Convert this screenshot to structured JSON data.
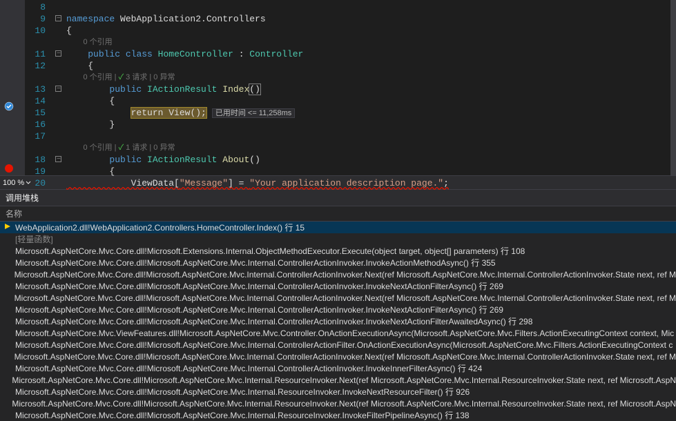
{
  "editor": {
    "lines": [
      {
        "num": "8",
        "codelens": null,
        "content": ""
      },
      {
        "num": "9",
        "codelens": null,
        "tokens": [
          {
            "t": "kw",
            "v": "namespace"
          },
          {
            "t": "p",
            "v": " WebApplication2.Controllers"
          }
        ],
        "outline": true
      },
      {
        "num": "10",
        "codelens": null,
        "tokens": [
          {
            "t": "p",
            "v": "{"
          }
        ]
      },
      {
        "num": "",
        "codelens": "0 个引用",
        "tokens": null
      },
      {
        "num": "11",
        "codelens": null,
        "tokens": [
          {
            "t": "p",
            "v": "    "
          },
          {
            "t": "kw",
            "v": "public"
          },
          {
            "t": "p",
            "v": " "
          },
          {
            "t": "kw",
            "v": "class"
          },
          {
            "t": "p",
            "v": " "
          },
          {
            "t": "type",
            "v": "HomeController"
          },
          {
            "t": "p",
            "v": " : "
          },
          {
            "t": "type",
            "v": "Controller"
          }
        ],
        "outline": true
      },
      {
        "num": "12",
        "codelens": null,
        "tokens": [
          {
            "t": "p",
            "v": "    {"
          }
        ]
      },
      {
        "num": "",
        "codelens": "0 个引用 | ✓ 3 请求 | 0 异常",
        "tokens": null
      },
      {
        "num": "13",
        "codelens": null,
        "tokens": [
          {
            "t": "p",
            "v": "        "
          },
          {
            "t": "kw",
            "v": "public"
          },
          {
            "t": "p",
            "v": " "
          },
          {
            "t": "type",
            "v": "IActionResult"
          },
          {
            "t": "p",
            "v": " "
          },
          {
            "t": "method",
            "v": "Index"
          },
          {
            "t": "caret",
            "v": "()"
          }
        ],
        "outline": true,
        "current": true
      },
      {
        "num": "14",
        "codelens": null,
        "tokens": [
          {
            "t": "p",
            "v": "        {"
          }
        ]
      },
      {
        "num": "15",
        "codelens": null,
        "tokens": [
          {
            "t": "p",
            "v": "            "
          },
          {
            "t": "hl",
            "v": "return View();"
          }
        ],
        "elapsed": "已用时间 <= 11,258ms"
      },
      {
        "num": "16",
        "codelens": null,
        "tokens": [
          {
            "t": "p",
            "v": "        }"
          }
        ]
      },
      {
        "num": "17",
        "codelens": null,
        "tokens": []
      },
      {
        "num": "",
        "codelens": "0 个引用 | ✓ 1 请求 | 0 异常",
        "tokens": null
      },
      {
        "num": "18",
        "codelens": null,
        "tokens": [
          {
            "t": "p",
            "v": "        "
          },
          {
            "t": "kw",
            "v": "public"
          },
          {
            "t": "p",
            "v": " "
          },
          {
            "t": "type",
            "v": "IActionResult"
          },
          {
            "t": "p",
            "v": " "
          },
          {
            "t": "method",
            "v": "About"
          },
          {
            "t": "p",
            "v": "()"
          }
        ],
        "outline": true
      },
      {
        "num": "19",
        "codelens": null,
        "tokens": [
          {
            "t": "p",
            "v": "        {"
          }
        ]
      },
      {
        "num": "20",
        "codelens": null,
        "tokens": [
          {
            "t": "p",
            "v": "            ViewData["
          },
          {
            "t": "str",
            "v": "\"Message\""
          },
          {
            "t": "p",
            "v": "] = "
          },
          {
            "t": "str",
            "v": "\"Your application description page.\""
          },
          {
            "t": "p",
            "v": ";"
          }
        ],
        "redunderline": true
      }
    ],
    "zoom": "100 %"
  },
  "callstack": {
    "panel_title": "调用堆栈",
    "column_header": "名称",
    "frames": [
      {
        "current": true,
        "text": "WebApplication2.dll!WebApplication2.Controllers.HomeController.Index() 行 15"
      },
      {
        "light": true,
        "text": "[轻量函数]"
      },
      {
        "text": "Microsoft.AspNetCore.Mvc.Core.dll!Microsoft.Extensions.Internal.ObjectMethodExecutor.Execute(object target, object[] parameters) 行 108"
      },
      {
        "text": "Microsoft.AspNetCore.Mvc.Core.dll!Microsoft.AspNetCore.Mvc.Internal.ControllerActionInvoker.InvokeActionMethodAsync() 行 355"
      },
      {
        "text": "Microsoft.AspNetCore.Mvc.Core.dll!Microsoft.AspNetCore.Mvc.Internal.ControllerActionInvoker.Next(ref Microsoft.AspNetCore.Mvc.Internal.ControllerActionInvoker.State next, ref M"
      },
      {
        "text": "Microsoft.AspNetCore.Mvc.Core.dll!Microsoft.AspNetCore.Mvc.Internal.ControllerActionInvoker.InvokeNextActionFilterAsync() 行 269"
      },
      {
        "text": "Microsoft.AspNetCore.Mvc.Core.dll!Microsoft.AspNetCore.Mvc.Internal.ControllerActionInvoker.Next(ref Microsoft.AspNetCore.Mvc.Internal.ControllerActionInvoker.State next, ref M"
      },
      {
        "text": "Microsoft.AspNetCore.Mvc.Core.dll!Microsoft.AspNetCore.Mvc.Internal.ControllerActionInvoker.InvokeNextActionFilterAsync() 行 269"
      },
      {
        "text": "Microsoft.AspNetCore.Mvc.Core.dll!Microsoft.AspNetCore.Mvc.Internal.ControllerActionInvoker.InvokeNextActionFilterAwaitedAsync() 行 298"
      },
      {
        "text": "Microsoft.AspNetCore.Mvc.ViewFeatures.dll!Microsoft.AspNetCore.Mvc.Controller.OnActionExecutionAsync(Microsoft.AspNetCore.Mvc.Filters.ActionExecutingContext context, Mic"
      },
      {
        "text": "Microsoft.AspNetCore.Mvc.Core.dll!Microsoft.AspNetCore.Mvc.Internal.ControllerActionFilter.OnActionExecutionAsync(Microsoft.AspNetCore.Mvc.Filters.ActionExecutingContext c"
      },
      {
        "text": "Microsoft.AspNetCore.Mvc.Core.dll!Microsoft.AspNetCore.Mvc.Internal.ControllerActionInvoker.Next(ref Microsoft.AspNetCore.Mvc.Internal.ControllerActionInvoker.State next, ref M"
      },
      {
        "text": "Microsoft.AspNetCore.Mvc.Core.dll!Microsoft.AspNetCore.Mvc.Internal.ControllerActionInvoker.InvokeInnerFilterAsync() 行 424"
      },
      {
        "text": "Microsoft.AspNetCore.Mvc.Core.dll!Microsoft.AspNetCore.Mvc.Internal.ResourceInvoker.Next(ref Microsoft.AspNetCore.Mvc.Internal.ResourceInvoker.State next, ref Microsoft.AspN"
      },
      {
        "text": "Microsoft.AspNetCore.Mvc.Core.dll!Microsoft.AspNetCore.Mvc.Internal.ResourceInvoker.InvokeNextResourceFilter() 行 926"
      },
      {
        "text": "Microsoft.AspNetCore.Mvc.Core.dll!Microsoft.AspNetCore.Mvc.Internal.ResourceInvoker.Next(ref Microsoft.AspNetCore.Mvc.Internal.ResourceInvoker.State next, ref Microsoft.AspN"
      },
      {
        "text": "Microsoft.AspNetCore.Mvc.Core.dll!Microsoft.AspNetCore.Mvc.Internal.ResourceInvoker.InvokeFilterPipelineAsync() 行 138"
      }
    ]
  }
}
